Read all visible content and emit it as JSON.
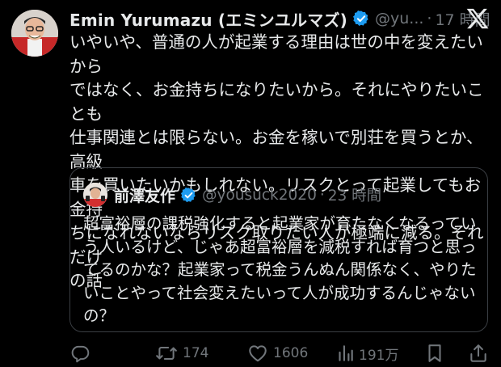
{
  "post": {
    "author_name": "Emin Yurumazu (エミンユルマズ)",
    "handle": "@yu...",
    "time": "17 時間",
    "text": "いやいや、普通の人が起業する理由は世の中を変えたいから\nではなく、お金持ちになりたいから。それにやりたいことも\n仕事関連とは限らない。お金を稼いで別荘を買うとか、高級\n車を買いたいかもしれない。リスクとって起業してもお金持\nちになれないならリスク取りたい人が極端に減る。それだけ\nの話"
  },
  "quote": {
    "author_name": "前澤友作",
    "handle": "@yousuck2020",
    "time": "23 時間",
    "text": "超富裕層の課税強化すると起業家が育たなくなるってい\nう人いるけど、じゃあ超富裕層を減税すれば育つと思っ\nてるのかな？起業家って税金うんぬん関係なく、やりた\nいことやって社会変えたいって人が成功するんじゃない\nの？"
  },
  "actions": {
    "reply_count": "",
    "retweet_count": "174",
    "like_count": "1606",
    "view_count": "191万"
  },
  "icons": {
    "verified": "verified-badge-icon",
    "platform": "x-logo-icon",
    "reply": "reply-icon",
    "retweet": "retweet-icon",
    "like": "heart-icon",
    "views": "views-icon",
    "bookmark": "bookmark-icon",
    "share": "share-icon"
  },
  "colors": {
    "background": "#000000",
    "text": "#e7e9ea",
    "muted": "#71767b",
    "verified": "#1d9bf0",
    "border": "#3b3f44"
  }
}
